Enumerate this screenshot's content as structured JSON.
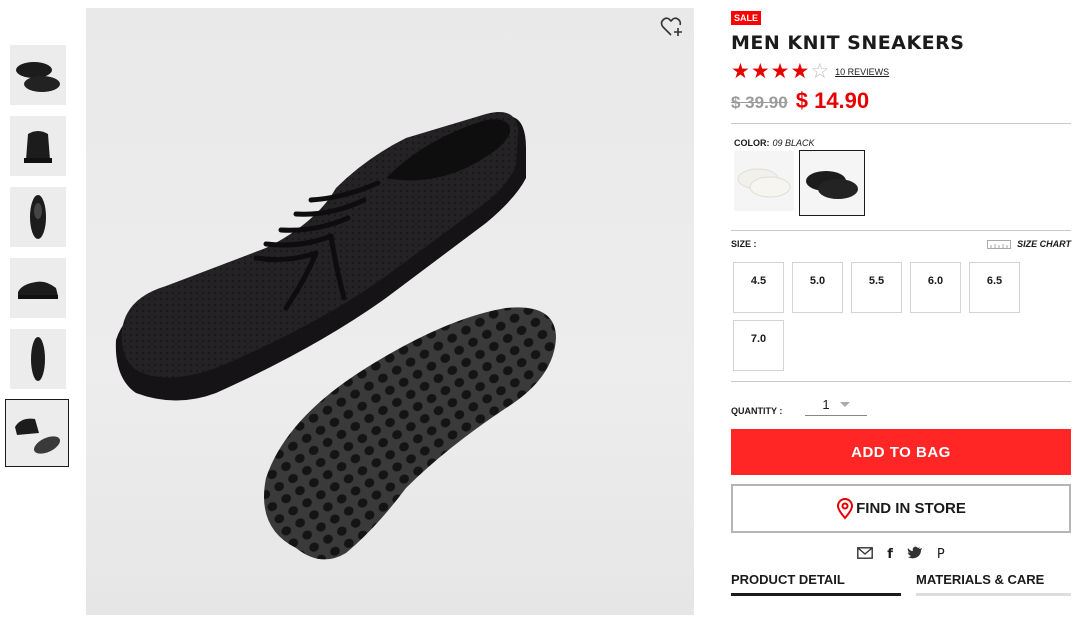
{
  "product": {
    "sale_badge": "SALE",
    "title": "MEN KNIT SNEAKERS",
    "rating": 4,
    "rating_max": 5,
    "reviews_label": "10 REVIEWS",
    "old_price": "$ 39.90",
    "new_price": "$ 14.90"
  },
  "color": {
    "label": "COLOR:",
    "value": "09 BLACK",
    "options": [
      "white",
      "black"
    ],
    "selected": "black"
  },
  "size": {
    "label": "SIZE :",
    "chart_label": "SIZE CHART",
    "options": [
      "4.5",
      "5.0",
      "5.5",
      "6.0",
      "6.5",
      "7.0"
    ]
  },
  "quantity": {
    "label": "QUANTITY :",
    "value": "1"
  },
  "actions": {
    "add_to_bag": "ADD TO BAG",
    "find_in_store": "FIND IN STORE"
  },
  "share": {
    "icons": [
      "mail-icon",
      "facebook-icon",
      "twitter-icon",
      "pinterest-icon"
    ],
    "facebook_glyph": "f",
    "pinterest_glyph": "P"
  },
  "tabs": {
    "product_detail": "PRODUCT DETAIL",
    "materials_care": "MATERIALS & CARE"
  },
  "colors": {
    "accent_red": "#ff2625",
    "price_red": "#e60000",
    "image_bg": "#ececec"
  }
}
